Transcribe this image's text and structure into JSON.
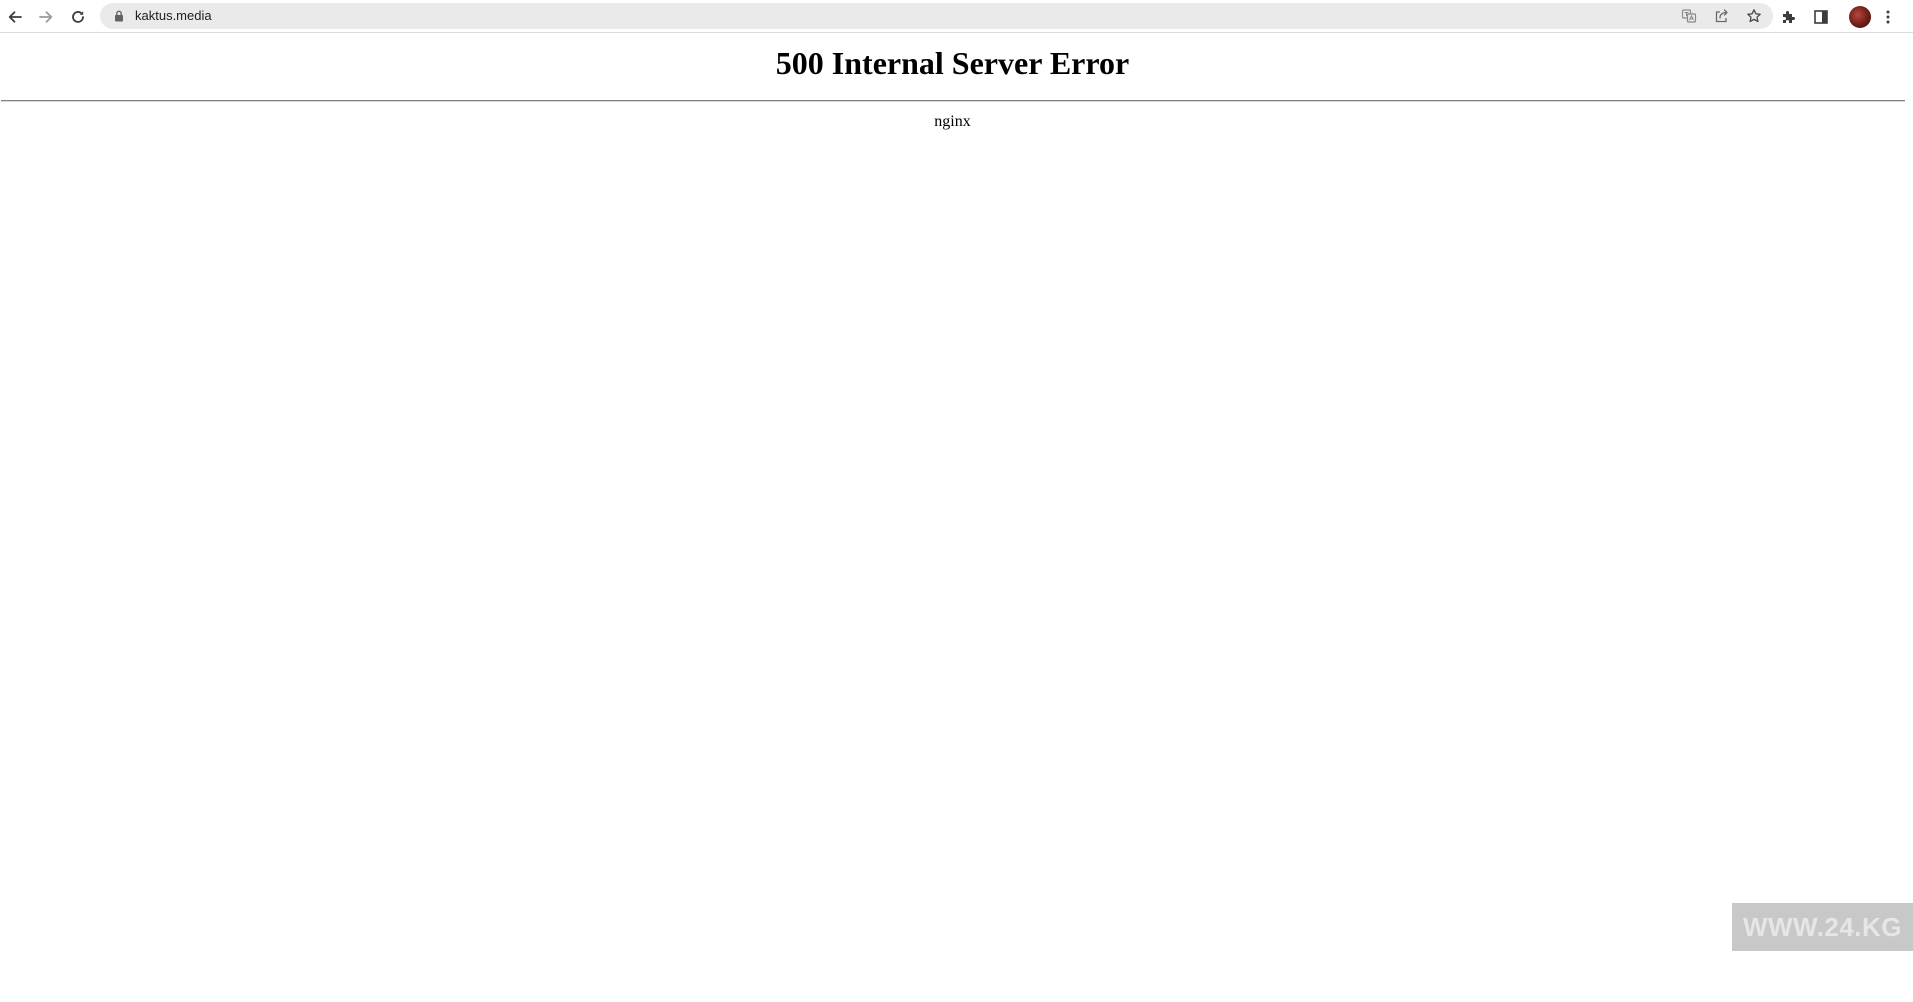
{
  "browser": {
    "url": "kaktus.media",
    "icons": {
      "back": "arrow-left-icon",
      "forward": "arrow-right-icon",
      "reload": "reload-icon",
      "lock": "lock-icon",
      "translate": "translate-icon",
      "share": "share-icon",
      "bookmark": "star-icon",
      "extensions": "puzzle-icon",
      "side_panel": "side-panel-icon",
      "profile": "avatar",
      "menu": "kebab-menu-icon"
    }
  },
  "page": {
    "title": "500 Internal Server Error",
    "server": "nginx"
  },
  "watermark": {
    "text": "WWW.24.KG"
  },
  "colors": {
    "background": "#ffffff",
    "omnibox": "#eaeaea",
    "text": "#000000",
    "watermark_bg": "#c8c8c8",
    "watermark_text": "#e6e6e6"
  }
}
